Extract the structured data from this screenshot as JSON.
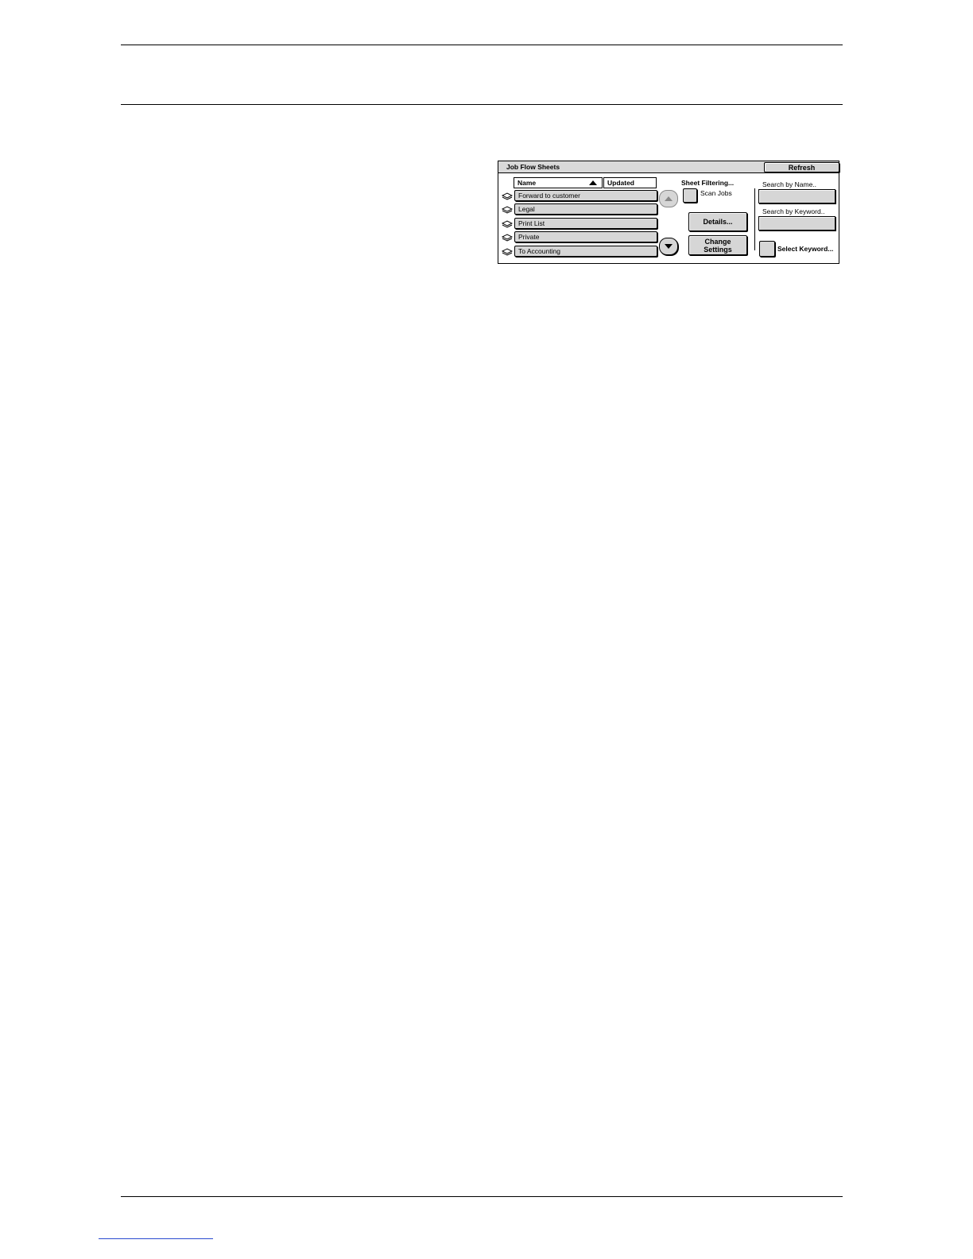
{
  "panel": {
    "title": "Job Flow Sheets",
    "refresh_label": "Refresh",
    "columns": {
      "name": "Name",
      "updated": "Updated"
    },
    "rows": [
      {
        "label": "Forward to customer"
      },
      {
        "label": "Legal"
      },
      {
        "label": "Print List"
      },
      {
        "label": "Private"
      },
      {
        "label": "To Accounting"
      }
    ],
    "sheet_filtering_label": "Sheet Filtering...",
    "scan_jobs_label": "Scan Jobs",
    "details_label": "Details...",
    "change_settings_line1": "Change",
    "change_settings_line2": "Settings",
    "search_by_name_label": "Search by Name..",
    "search_by_keyword_label": "Search by Keyword..",
    "select_keyword_label": "Select Keyword...",
    "icons": {
      "row_icon": "document-stack-icon",
      "sort": "sort-ascending-icon",
      "scroll_up": "scroll-up-icon",
      "scroll_down": "scroll-down-icon"
    }
  }
}
